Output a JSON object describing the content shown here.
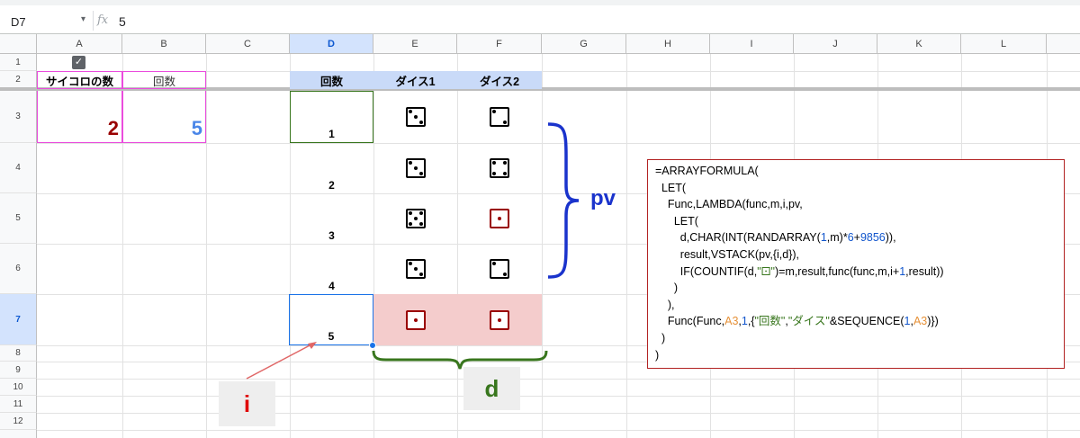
{
  "formula_bar": {
    "cell_ref": "D7",
    "arrow": "▾",
    "fx": "fx",
    "value": "5"
  },
  "columns": [
    "A",
    "B",
    "C",
    "D",
    "E",
    "F",
    "G",
    "H",
    "I",
    "J",
    "K",
    "L"
  ],
  "rows": [
    "1",
    "2",
    "3",
    "4",
    "5",
    "6",
    "7",
    "8",
    "9",
    "10",
    "11",
    "12"
  ],
  "sheet": {
    "a2": "サイコロの数",
    "b2": "回数",
    "a3": "2",
    "b3": "5",
    "d2": "回数",
    "e2": "ダイス1",
    "f2": "ダイス2",
    "turns": [
      "1",
      "2",
      "3",
      "4",
      "5"
    ],
    "dice": [
      {
        "e": 3,
        "f": 2
      },
      {
        "e": 3,
        "f": 4
      },
      {
        "e": 5,
        "f": 1
      },
      {
        "e": 3,
        "f": 2
      },
      {
        "e": 1,
        "f": 1
      }
    ],
    "checkbox_checked": true
  },
  "annotations": {
    "pv": "pv",
    "i": "i",
    "d": "d"
  },
  "colors": {
    "red": "#990000",
    "blue": "#4a86e8",
    "pv_blue": "#1a33cc",
    "green": "#38761d",
    "pink_border": "#ea4cdd",
    "selection": "#1a73e8",
    "row7_fill": "#f4cccc"
  },
  "formula_lines": [
    "=ARRAYFORMULA(",
    "  LET(",
    "    Func,LAMBDA(func,m,i,pv,",
    "      LET(",
    "        d,CHAR(INT(RANDARRAY(1,m)*6+9856)),",
    "        result,VSTACK(pv,{i,d}),",
    "        IF(COUNTIF(d,\"⚀\")=m,result,func(func,m,i+1,result))",
    "      )",
    "    ),",
    "    Func(Func,A3,1,{\"回数\",\"ダイス\"&SEQUENCE(1,A3)})",
    "  )",
    ")"
  ]
}
